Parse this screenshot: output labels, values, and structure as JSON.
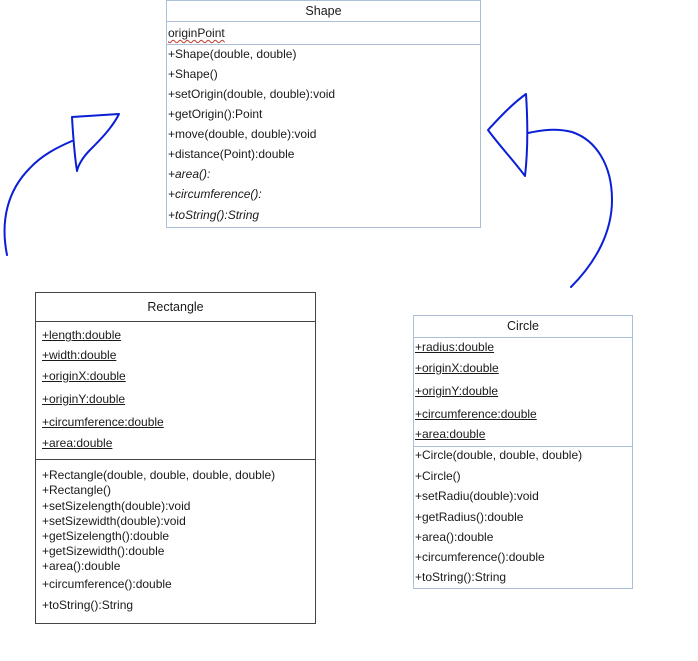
{
  "shape": {
    "name": "Shape",
    "attributes": [
      "originPoint"
    ],
    "methods": [
      "+Shape(double, double)",
      "+Shape()",
      "+setOrigin(double, double):void",
      "+getOrigin():Point",
      "+move(double, double):void",
      "+distance(Point):double",
      "+area():",
      "+circumference():",
      "+toString():String"
    ]
  },
  "rectangle": {
    "name": "Rectangle",
    "attributes": [
      "+length:double",
      "+width:double",
      "+originX:double",
      "+originY:double",
      "+circumference:double",
      "+area:double"
    ],
    "methods": [
      "+Rectangle(double, double, double, double)",
      "+Rectangle()",
      "+setSizelength(double):void",
      "+setSizewidth(double):void",
      "+getSizelength():double",
      "+getSizewidth():double",
      "+area():double",
      "+circumference():double",
      "+toString():String"
    ]
  },
  "circle": {
    "name": "Circle",
    "attributes": [
      "+radius:double",
      "+originX:double",
      "+originY:double",
      "+circumference:double",
      "+area:double"
    ],
    "methods": [
      "+Circle(double, double, double)",
      "+Circle()",
      "+setRadiu(double):void",
      "+getRadius():double",
      "+area():double",
      "+circumference():double",
      "+toString():String"
    ]
  },
  "colors": {
    "ink": "#0a1fd6",
    "box_border": "#a9c0d8",
    "rect_border": "#444444",
    "squiggle": "#c0392b"
  }
}
